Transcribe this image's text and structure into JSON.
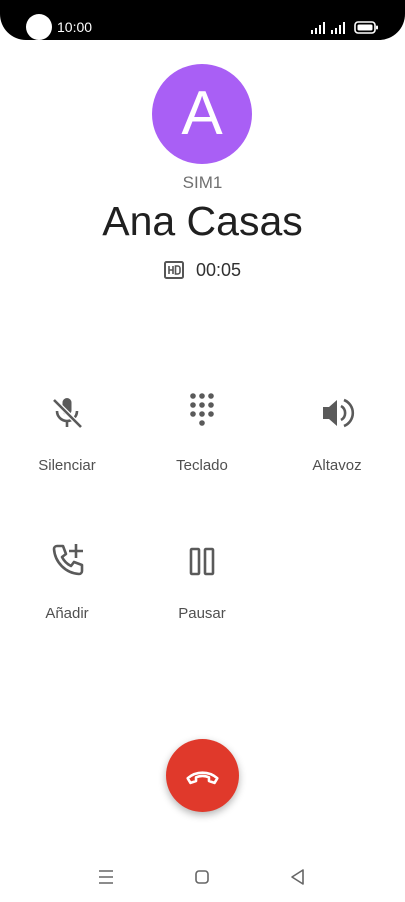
{
  "status_bar": {
    "time": "10:00"
  },
  "contact": {
    "initial": "A",
    "sim": "SIM1",
    "name": "Ana Casas",
    "duration": "00:05",
    "avatar_color": "#a95ff5"
  },
  "controls": {
    "mute": {
      "label": "Silenciar",
      "icon": "mic-off-icon"
    },
    "keypad": {
      "label": "Teclado",
      "icon": "dialpad-icon"
    },
    "speaker": {
      "label": "Altavoz",
      "icon": "speaker-icon"
    },
    "add": {
      "label": "Añadir",
      "icon": "add-call-icon"
    },
    "hold": {
      "label": "Pausar",
      "icon": "pause-icon"
    }
  },
  "end_call": {
    "icon": "hang-up-icon",
    "color": "#e0392b"
  },
  "nav_bar": {
    "menu_icon": "menu-icon",
    "home_icon": "home-icon",
    "back_icon": "back-icon"
  }
}
